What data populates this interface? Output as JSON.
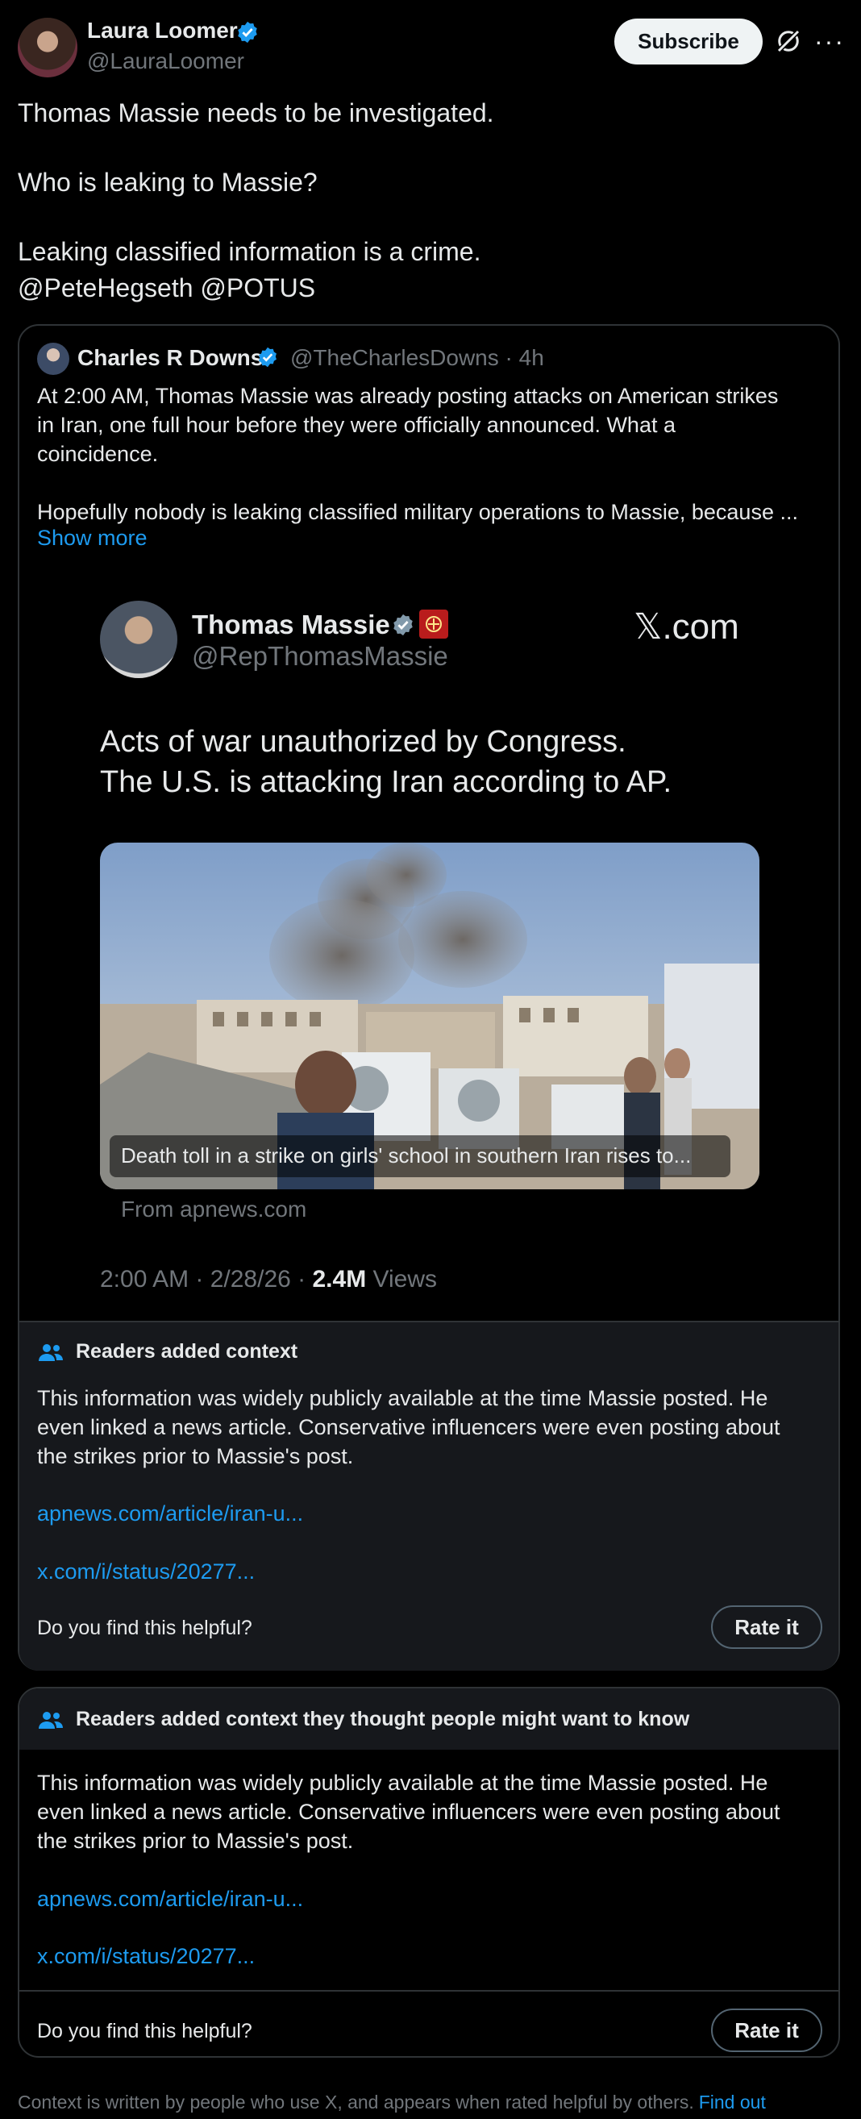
{
  "post": {
    "author_name": "Laura Loomer",
    "author_handle": "@LauraLoomer",
    "subscribe_label": "Subscribe",
    "text_line1": "Thomas Massie needs to be investigated.",
    "text_line2": "Who is leaking to Massie?",
    "text_line3": "Leaking classified information is a crime.",
    "mentions": "@PeteHegseth @POTUS"
  },
  "quote": {
    "author_name": "Charles R Downs",
    "author_handle": "@TheCharlesDowns · 4h",
    "text_p1_l1": "At 2:00 AM, Thomas Massie was already posting attacks on American strikes",
    "text_p1_l2": "in Iran, one full hour before they were officially announced. What a",
    "text_p1_l3": "coincidence.",
    "text_p2_l1": "Hopefully nobody is leaking classified military operations to Massie, because ...",
    "show_more": "Show more"
  },
  "embedded": {
    "name": "Thomas Massie",
    "handle": "@RepThomasMassie",
    "site": "𝕏.com",
    "text_l1": "Acts of war unauthorized by Congress.",
    "text_l2": "The U.S. is attacking Iran according to AP.",
    "image_caption": "Death toll in a strike on girls' school in southern Iran rises to...",
    "source": "From apnews.com",
    "meta_prefix": "2:00 AM · 2/28/26 · ",
    "views_count": "2.4M",
    "views_label": " Views"
  },
  "note1": {
    "title": "Readers added context",
    "body_l1": "This information was widely publicly available at the time Massie posted. He",
    "body_l2": "even linked a news article.  Conservative influencers were even posting about",
    "body_l3": "the strikes prior to Massie's post.",
    "link1": "apnews.com/article/iran-u...",
    "link2": "x.com/i/status/20277...",
    "helpful_question": "Do you find this helpful?",
    "rate_label": "Rate it"
  },
  "note2": {
    "title": "Readers added context they thought people might want to know",
    "body_l1": "This information was widely publicly available at the time Massie posted. He",
    "body_l2": "even linked a news article.  Conservative influencers were even posting about",
    "body_l3": "the strikes prior to Massie's post.",
    "link1": "apnews.com/article/iran-u...",
    "link2": "x.com/i/status/20277...",
    "helpful_question": "Do you find this helpful?",
    "rate_label": "Rate it"
  },
  "footer": {
    "text": "Context is written by people who use X, and appears when rated helpful by others.",
    "link": "Find out"
  },
  "colors": {
    "background": "#000000",
    "link_blue": "#1d9bf0",
    "muted_gray": "#71767b",
    "note_bg": "#16181c"
  }
}
